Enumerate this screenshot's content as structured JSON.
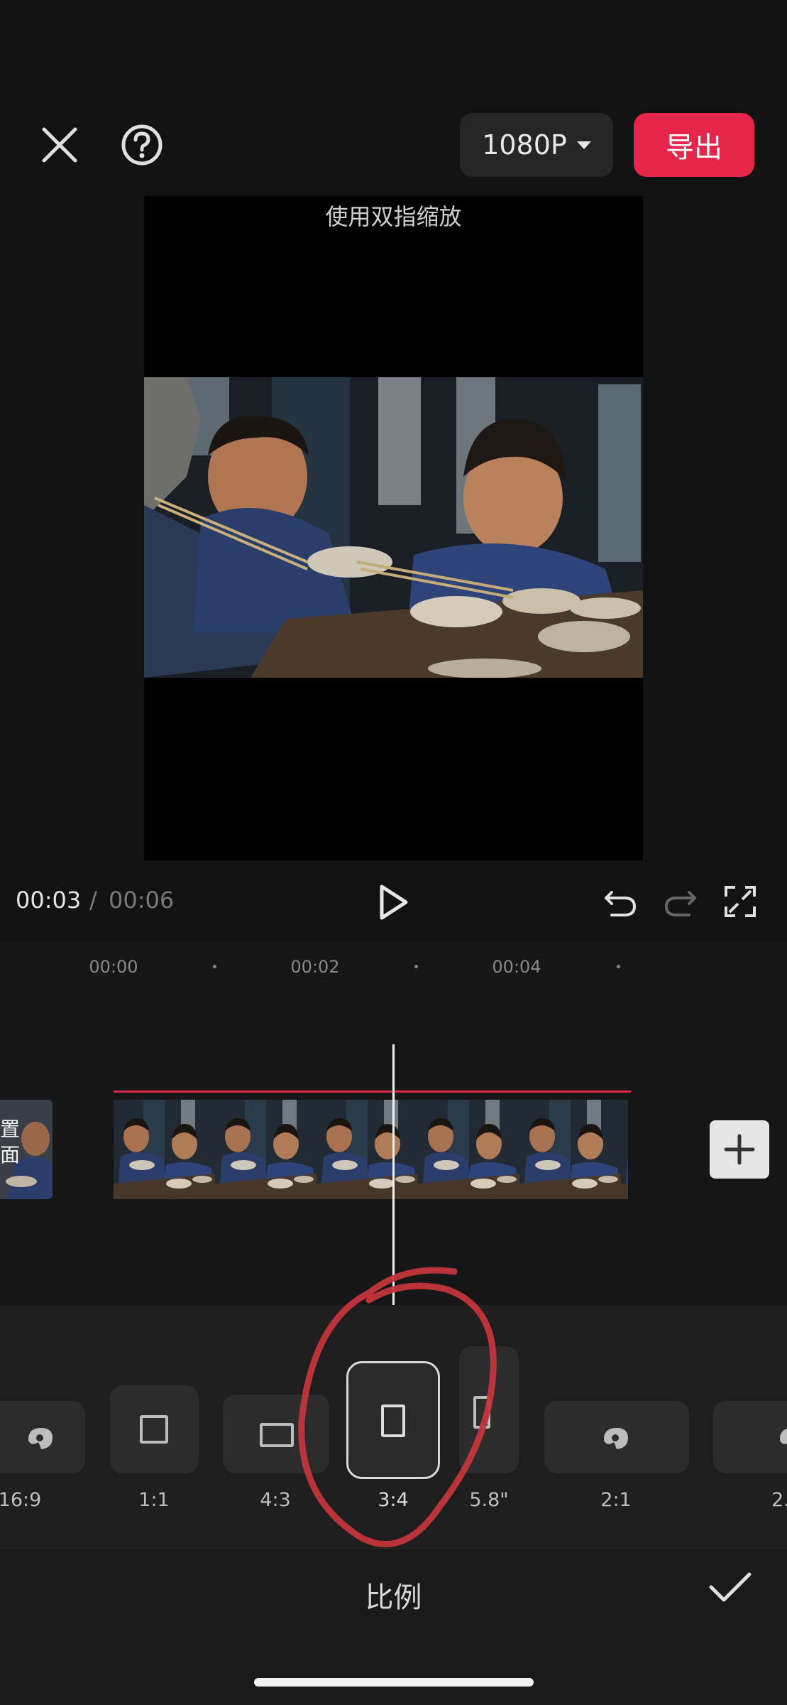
{
  "header": {
    "resolution_label": "1080P",
    "export_label": "导出"
  },
  "preview": {
    "hint": "使用双指缩放"
  },
  "playback": {
    "current_time": "00:03",
    "separator": "/",
    "total_time": "00:06"
  },
  "timeline": {
    "ticks": [
      "00:00",
      "00:02",
      "00:04"
    ],
    "cover_label_line1": "置",
    "cover_label_line2": "面"
  },
  "ratio_panel": {
    "options": [
      {
        "label": "16:9"
      },
      {
        "label": "1:1"
      },
      {
        "label": "4:3"
      },
      {
        "label": "3:4",
        "selected": true
      },
      {
        "label": "5.8\""
      },
      {
        "label": "2:1"
      },
      {
        "label": "2."
      }
    ]
  },
  "footer": {
    "title": "比例"
  },
  "colors": {
    "accent": "#e5254a",
    "annotation": "#c2353a",
    "background": "#121212"
  },
  "icons": [
    "close-icon",
    "help-icon",
    "caret-down-icon",
    "play-icon",
    "undo-icon",
    "redo-icon",
    "fullscreen-icon",
    "plus-icon",
    "tiktok-icon",
    "checkmark-icon"
  ]
}
